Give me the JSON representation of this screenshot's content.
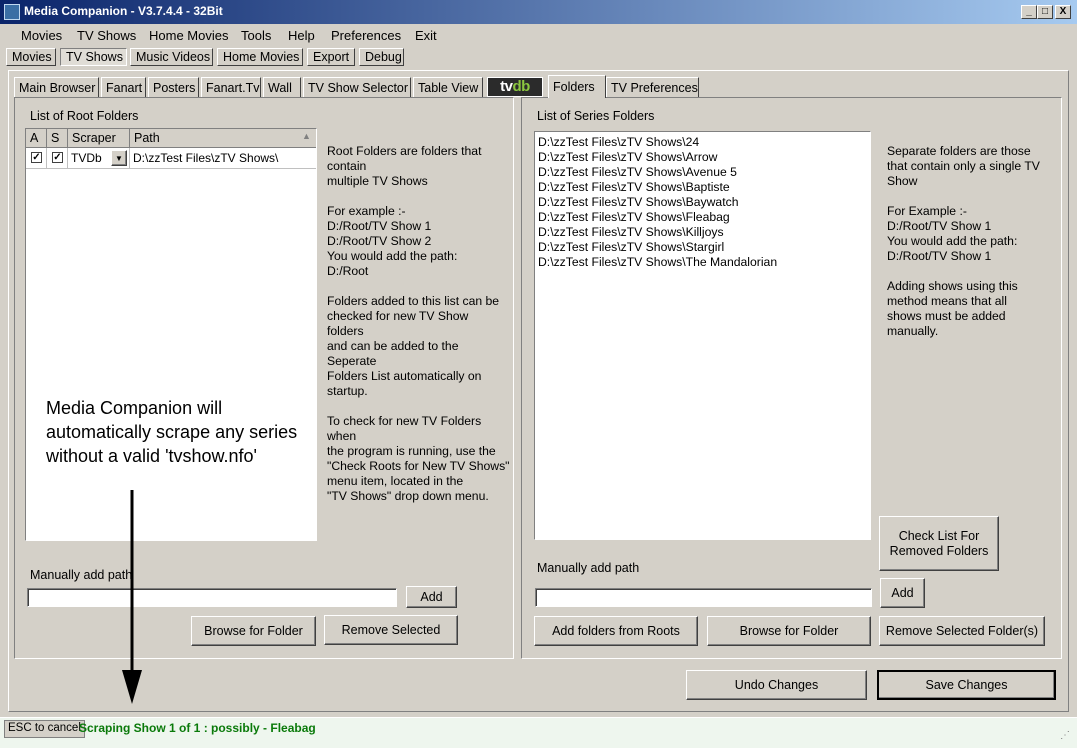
{
  "window": {
    "title": "Media Companion - V3.7.4.4 - 32Bit",
    "min_glyph": "_",
    "max_glyph": "□",
    "close_glyph": "X"
  },
  "menu": [
    "Movies",
    "TV Shows",
    "Home Movies",
    "Tools",
    "Help",
    "Preferences",
    "Exit"
  ],
  "top_tabs": [
    "Movies",
    "TV Shows",
    "Music Videos",
    "Home Movies",
    "Export",
    "Debug"
  ],
  "sub_tabs": [
    "Main Browser",
    "Fanart",
    "Posters",
    "Fanart.Tv",
    "Wall",
    "TV Show Selector",
    "Table View",
    "Folders",
    "TV Preferences"
  ],
  "logo": {
    "part1": "tv",
    "part2": "db"
  },
  "left": {
    "caption": "List of Root Folders",
    "columns": {
      "a": "A",
      "s": "S",
      "scraper": "Scraper",
      "path": "Path"
    },
    "rows": [
      {
        "a": "✓",
        "s": "✓",
        "scraper": "TVDb",
        "path": "D:\\zzTest Files\\zTV Shows\\"
      }
    ],
    "info": "Root Folders are folders that\ncontain\nmultiple TV Shows\n\nFor example :-\nD:/Root/TV Show 1\nD:/Root/TV Show 2\nYou would add the path:\nD:/Root\n\nFolders added to this list can be\nchecked for new TV Show\nfolders\nand can be added to the\nSeperate\nFolders List automatically on\nstartup.\n\nTo check for new TV Folders\nwhen\nthe program is running, use the\n\"Check Roots for New TV Shows\"\nmenu item, located in the\n\"TV Shows\" drop down menu.",
    "manual_label": "Manually add path",
    "manual_value": "",
    "add_label": "Add",
    "browse_label": "Browse for Folder",
    "remove_label": "Remove Selected"
  },
  "right": {
    "caption": "List of Series Folders",
    "folders": [
      "D:\\zzTest Files\\zTV Shows\\24",
      "D:\\zzTest Files\\zTV Shows\\Arrow",
      "D:\\zzTest Files\\zTV Shows\\Avenue 5",
      "D:\\zzTest Files\\zTV Shows\\Baptiste",
      "D:\\zzTest Files\\zTV Shows\\Baywatch",
      "D:\\zzTest Files\\zTV Shows\\Fleabag",
      "D:\\zzTest Files\\zTV Shows\\Killjoys",
      "D:\\zzTest Files\\zTV Shows\\Stargirl",
      "D:\\zzTest Files\\zTV Shows\\The Mandalorian"
    ],
    "info": "Separate folders are those\nthat contain only a single TV\nShow\n\nFor Example :-\nD:/Root/TV Show 1\nYou would add the path:\nD:/Root/TV Show 1\n\nAdding shows using this\nmethod means that all\nshows must be added\nmanually.",
    "check_label_1": "Check List For",
    "check_label_2": "Removed Folders",
    "manual_label": "Manually add path",
    "manual_value": "",
    "add_label": "Add",
    "add_roots_label": "Add folders from Roots",
    "browse_label": "Browse for Folder",
    "remove_label": "Remove Selected Folder(s)"
  },
  "undo_label": "Undo Changes",
  "save_label": "Save Changes",
  "annotation": "Media Companion will\nautomatically scrape any series\nwithout a valid 'tvshow.nfo'",
  "status": {
    "esc_label": "ESC to cancel",
    "message": "Scraping Show 1 of 1 :  possibly - Fleabag"
  }
}
